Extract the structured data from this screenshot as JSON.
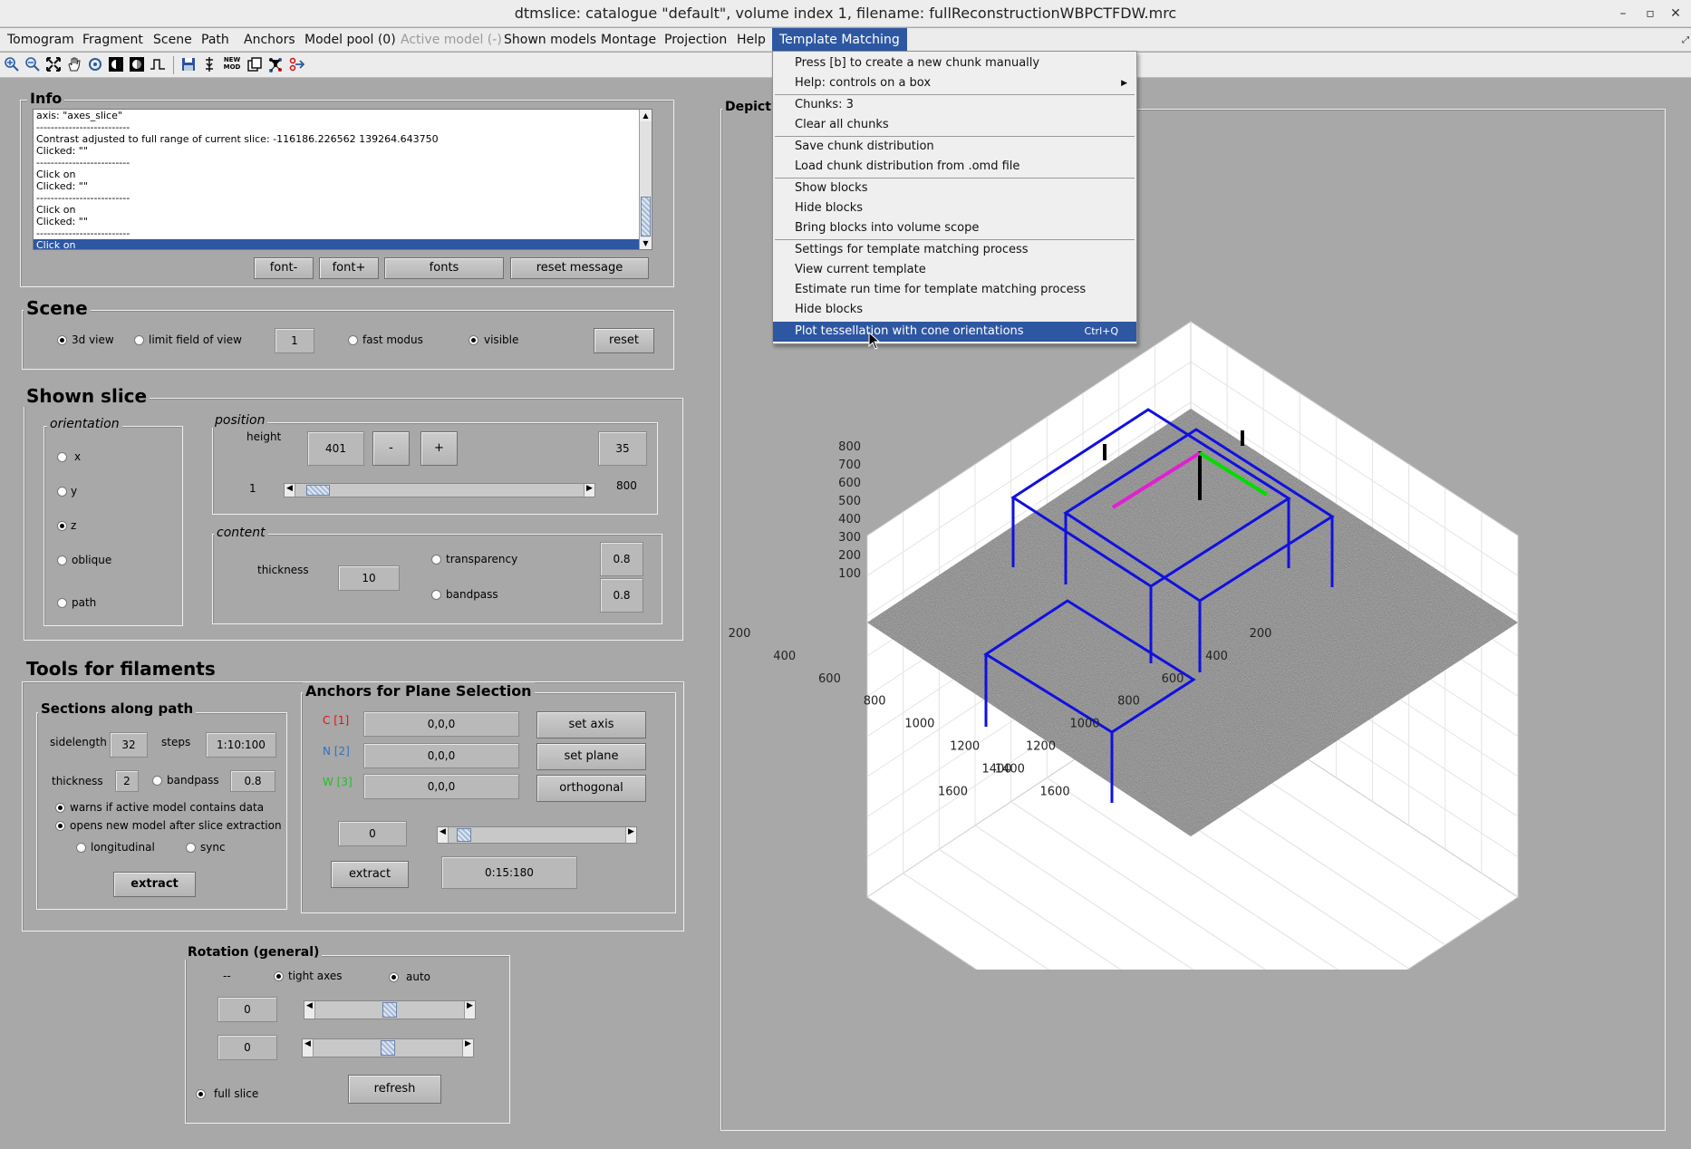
{
  "window": {
    "title": "dtmslice: catalogue \"default\", volume index 1, filename: fullReconstructionWBPCTFDW.mrc",
    "minimize": "–",
    "maximize": "▫",
    "close": "✕"
  },
  "menubar": [
    {
      "label": "Tomogram",
      "state": "normal"
    },
    {
      "label": "Fragment",
      "state": "normal"
    },
    {
      "label": "Scene",
      "state": "normal"
    },
    {
      "label": "Path",
      "state": "normal"
    },
    {
      "label": "Anchors",
      "state": "normal"
    },
    {
      "label": "Model pool (0)",
      "state": "normal"
    },
    {
      "label": "Active model (-)",
      "state": "disabled"
    },
    {
      "label": "Shown models",
      "state": "normal"
    },
    {
      "label": "Montage",
      "state": "normal"
    },
    {
      "label": "Projection",
      "state": "normal"
    },
    {
      "label": "Help",
      "state": "normal"
    },
    {
      "label": "Template Matching",
      "state": "open"
    }
  ],
  "toolbar_icons": [
    "zoom-in-icon",
    "zoom-out-icon",
    "fit-icon",
    "pan-hand-icon",
    "rotate-icon",
    "contrast-icon",
    "contrast-alt-icon",
    "profile-icon",
    "save-icon",
    "marker-icon",
    "new-mod-icon",
    "copy-icon",
    "network-icon",
    "anchor-tool-icon"
  ],
  "new_mod_label": "NEW MOD",
  "colors": {
    "accent": "#2e57a2",
    "background": "#a8a8a8",
    "blocks": "#1010e0",
    "axis_x": "#e020d0",
    "axis_y": "#00dd00",
    "anchor_c": "#e01010",
    "anchor_n": "#3070c0",
    "anchor_w": "#20c020"
  },
  "info": {
    "title": "Info",
    "lines": [
      "axis: \"axes_slice\"",
      "--------------------------",
      "Contrast adjusted to full range of current slice: -116186.226562 139264.643750",
      "Clicked: \"\"",
      "--------------------------",
      "Click on",
      "Clicked: \"\"",
      "--------------------------",
      "Click on",
      "Clicked: \"\"",
      "--------------------------",
      "Click on"
    ],
    "buttons": {
      "font_minus": "font-",
      "font_plus": "font+",
      "fonts": "fonts",
      "reset_message": "reset message"
    }
  },
  "scene": {
    "title": "Scene",
    "view_3d": "3d view",
    "limit_fov": "limit field of view",
    "fov_value": "1",
    "fast_modus": "fast modus",
    "visible": "visible",
    "reset": "reset"
  },
  "shown_slice": {
    "title": "Shown slice",
    "orientation": {
      "title": "orientation",
      "options": [
        "x",
        "y",
        "z",
        "oblique",
        "path"
      ],
      "selected": "z"
    },
    "position": {
      "title": "position",
      "height_label": "height",
      "height_value": "401",
      "minus": "-",
      "plus": "+",
      "step_value": "35",
      "min": "1",
      "max": "800",
      "slider_fraction": 0.04
    },
    "content": {
      "title": "content",
      "thickness_label": "thickness",
      "thickness_value": "10",
      "transparency": "transparency",
      "transparency_value": "0.8",
      "bandpass": "bandpass",
      "bandpass_value": "0.8"
    }
  },
  "filaments": {
    "title": "Tools for filaments",
    "sections": {
      "title": "Sections along path",
      "sidelength_label": "sidelength",
      "sidelength_value": "32",
      "steps_label": "steps",
      "steps_value": "1:10:100",
      "thickness_label": "thickness",
      "thickness_value": "2",
      "bandpass_label": "bandpass",
      "bandpass_value": "0.8",
      "warns": "warns if active model contains data",
      "opens": "opens new model after slice extraction",
      "longitudinal": "longitudinal",
      "sync": "sync",
      "extract": "extract"
    },
    "anchors": {
      "title": "Anchors for Plane Selection",
      "c_label": "C [1]",
      "c_value": "0,0,0",
      "n_label": "N [2]",
      "n_value": "0,0,0",
      "w_label": "W [3]",
      "w_value": "0,0,0",
      "set_axis": "set axis",
      "set_plane": "set plane",
      "orthogonal": "orthogonal",
      "angle_value": "0",
      "slider_fraction": 0.05,
      "extract": "extract",
      "range_value": "0:15:180"
    }
  },
  "rotation": {
    "title": "Rotation (general)",
    "dash": "--",
    "tight_axes": "tight axes",
    "auto": "auto",
    "value1": "0",
    "value2": "0",
    "slider1_fraction": 0.5,
    "slider2_fraction": 0.5,
    "full_slice": "full slice",
    "refresh": "refresh"
  },
  "depiction": {
    "title": "Depicti"
  },
  "template_menu": {
    "items": [
      {
        "label": "Press [b] to create a new chunk manually"
      },
      {
        "label": "Help: controls on a box",
        "submenu": true
      },
      {
        "label": "Chunks: 3",
        "sep": true
      },
      {
        "label": "Clear all chunks"
      },
      {
        "label": "Save chunk distribution",
        "sep": true
      },
      {
        "label": "Load chunk distribution from .omd file"
      },
      {
        "label": "Show blocks",
        "sep": true
      },
      {
        "label": "Hide blocks"
      },
      {
        "label": "Bring blocks into volume scope"
      },
      {
        "label": "Settings for template matching process",
        "sep": true
      },
      {
        "label": "View current template"
      },
      {
        "label": "Estimate run time for template matching process"
      },
      {
        "label": "Hide blocks"
      },
      {
        "label": "Plot tessellation with cone orientations",
        "shortcut": "Ctrl+Q",
        "highlighted": true
      }
    ]
  },
  "plot3d": {
    "z_ticks": [
      "800",
      "700",
      "600",
      "500",
      "400",
      "300",
      "200",
      "100"
    ],
    "x_ticks": [
      "200",
      "400",
      "600",
      "800",
      "1000",
      "1200",
      "1400",
      "1600"
    ],
    "y_ticks": [
      "200",
      "400",
      "600",
      "800",
      "1000",
      "1200",
      "1400",
      "1600"
    ],
    "grid": true
  }
}
